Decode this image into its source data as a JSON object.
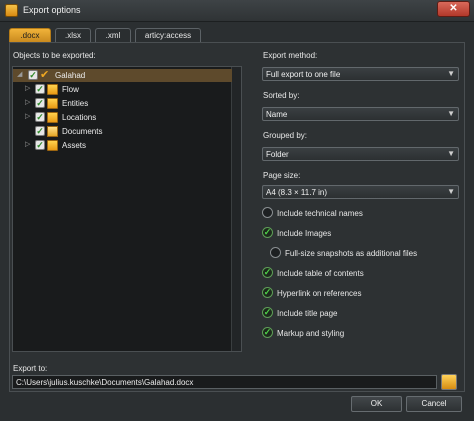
{
  "window": {
    "title": "Export options",
    "close_label": "✕"
  },
  "tabs": [
    {
      "label": ".docx",
      "active": true
    },
    {
      "label": ".xlsx",
      "active": false
    },
    {
      "label": ".xml",
      "active": false
    },
    {
      "label": "articy:access",
      "active": false
    }
  ],
  "objects": {
    "label": "Objects to be exported:",
    "tree": [
      {
        "label": "Galahad",
        "icon": "star-icon",
        "checked": true,
        "expanded": true,
        "selected": true
      },
      {
        "label": "Flow",
        "icon": "folder-icon",
        "checked": true,
        "expanded": false
      },
      {
        "label": "Entities",
        "icon": "folder-icon",
        "checked": true,
        "expanded": false
      },
      {
        "label": "Locations",
        "icon": "folder-icon",
        "checked": true,
        "expanded": false
      },
      {
        "label": "Documents",
        "icon": "document-icon",
        "checked": true,
        "expanded": false
      },
      {
        "label": "Assets",
        "icon": "folder-icon",
        "checked": true,
        "expanded": false
      }
    ]
  },
  "options": {
    "export_method": {
      "label": "Export method:",
      "value": "Full export to one file"
    },
    "sorted_by": {
      "label": "Sorted by:",
      "value": "Name"
    },
    "grouped_by": {
      "label": "Grouped by:",
      "value": "Folder"
    },
    "page_size": {
      "label": "Page size:",
      "value": "A4 (8.3 × 11.7 in)"
    },
    "checkboxes": [
      {
        "label": "Include technical names",
        "checked": false
      },
      {
        "label": "Include Images",
        "checked": true
      },
      {
        "label": "Full-size snapshots as additional files",
        "checked": false
      },
      {
        "label": "Include table of contents",
        "checked": true
      },
      {
        "label": "Hyperlink on references",
        "checked": true
      },
      {
        "label": "Include title page",
        "checked": true
      },
      {
        "label": "Markup and styling",
        "checked": true
      }
    ]
  },
  "export_to": {
    "label": "Export to:",
    "value": "C:\\Users\\julius.kuschke\\Documents\\Galahad.docx"
  },
  "buttons": {
    "ok": "OK",
    "cancel": "Cancel"
  },
  "colors": {
    "accent": "#f0b33a",
    "check": "#4fd04a",
    "background": "#2b2f31"
  }
}
